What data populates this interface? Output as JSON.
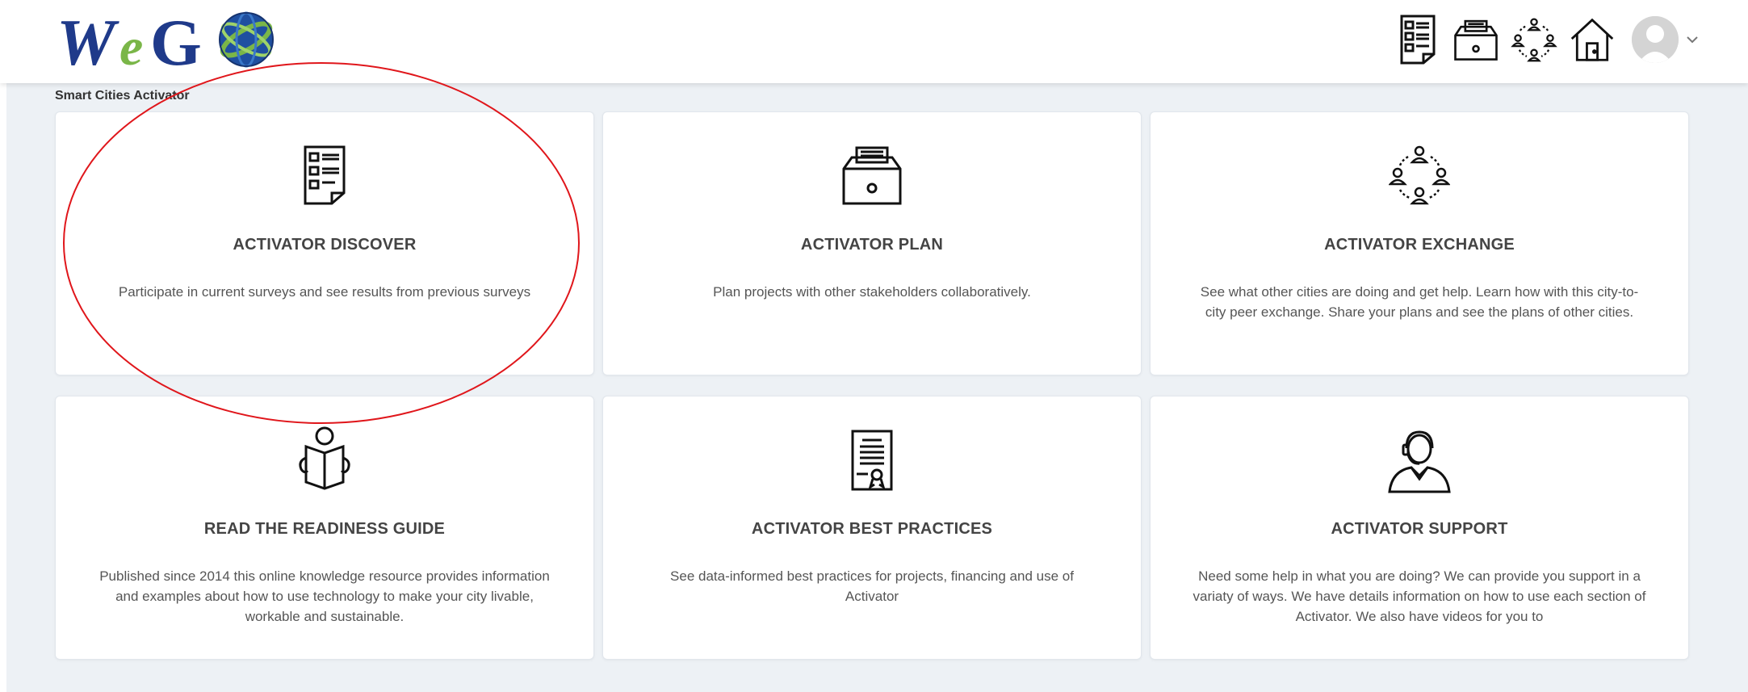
{
  "header": {
    "logo_text": "WeGO",
    "nav": [
      {
        "icon": "survey-document-icon"
      },
      {
        "icon": "file-cabinet-icon"
      },
      {
        "icon": "people-exchange-icon"
      },
      {
        "icon": "home-icon"
      }
    ],
    "account": {
      "icon": "user-avatar-icon"
    }
  },
  "main": {
    "section_title": "Smart Cities Activator",
    "cards": [
      {
        "title": "ACTIVATOR DISCOVER",
        "description": "Participate in current surveys and see results from previous surveys",
        "icon": "survey-document-icon"
      },
      {
        "title": "ACTIVATOR PLAN",
        "description": "Plan projects with other stakeholders collaboratively.",
        "icon": "file-cabinet-icon"
      },
      {
        "title": "ACTIVATOR EXCHANGE",
        "description": "See what other cities are doing and get help. Learn how with this city-to-city peer exchange. Share your plans and see the plans of other cities.",
        "icon": "people-exchange-icon"
      },
      {
        "title": "READ THE READINESS GUIDE",
        "description": "Published since 2014 this online knowledge resource provides information and examples about how to use technology to make your city livable, workable and sustainable.",
        "icon": "reading-person-icon"
      },
      {
        "title": "ACTIVATOR BEST PRACTICES",
        "description": "See data-informed best practices for projects, financing and use of Activator",
        "icon": "certificate-icon"
      },
      {
        "title": "ACTIVATOR SUPPORT",
        "description": "Need some help in what you are doing? We can provide you support in a variaty of ways. We have details information on how to use each section of Activator. We also have videos for you to",
        "icon": "support-agent-icon"
      }
    ]
  },
  "colors": {
    "background": "#edf1f5",
    "logo_blue": "#1f3a8a",
    "logo_green": "#7ab648",
    "annotation": "#e0161b"
  }
}
